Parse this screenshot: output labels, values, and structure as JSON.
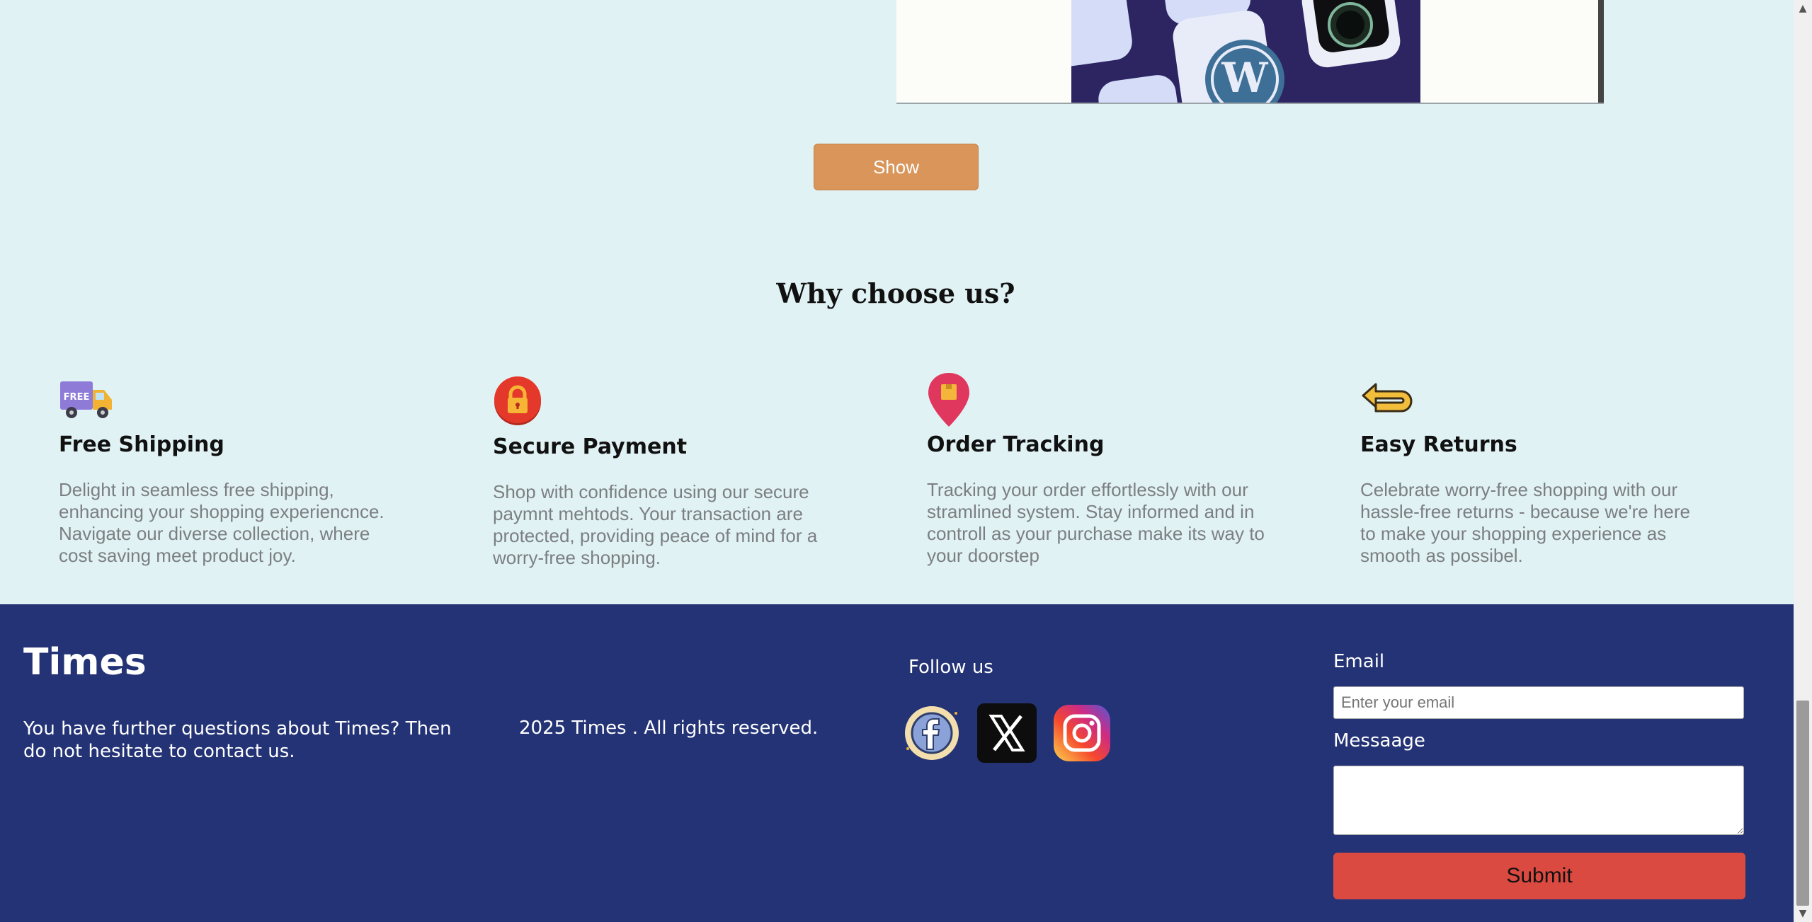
{
  "gallery": {
    "show_button": "Show"
  },
  "why": {
    "title": "Why choose us?",
    "features": [
      {
        "icon": "free-shipping-truck-icon",
        "badge": "FREE",
        "title": "Free Shipping",
        "text": "Delight in seamless free shipping, enhancing your shopping experiencnce. Navigate our diverse collection, where cost saving meet product joy."
      },
      {
        "icon": "lock-icon",
        "title": "Secure Payment",
        "text": "Shop with confidence using our secure paymnt mehtods. Your transaction are protected, providing peace of mind for a worry-free shopping."
      },
      {
        "icon": "map-pin-icon",
        "title": "Order Tracking",
        "text": "Tracking your order effortlessly with our stramlined system. Stay informed and in controll as your purchase make its way to your doorstep"
      },
      {
        "icon": "return-arrow-icon",
        "title": "Easy Returns",
        "text": "Celebrate worry-free shopping with our hassle-free returns - because we're here to make your shopping experience as smooth as possibel."
      }
    ]
  },
  "footer": {
    "brand": "Times",
    "contact_text": "You have further questions about Times? Then do not hesitate to contact us.",
    "copyright": "2025 Times . All rights reserved.",
    "follow_label": "Follow us",
    "socials": [
      "facebook-icon",
      "x-icon",
      "instagram-icon"
    ],
    "form": {
      "email_label": "Email",
      "email_placeholder": "Enter your email",
      "email_value": "",
      "message_label": "Messaage",
      "message_value": "",
      "submit_label": "Submit"
    }
  },
  "colors": {
    "page_bg": "#e1f2f4",
    "footer_bg": "#233375",
    "show_button": "#d9955a",
    "submit_button": "#db4a41"
  }
}
